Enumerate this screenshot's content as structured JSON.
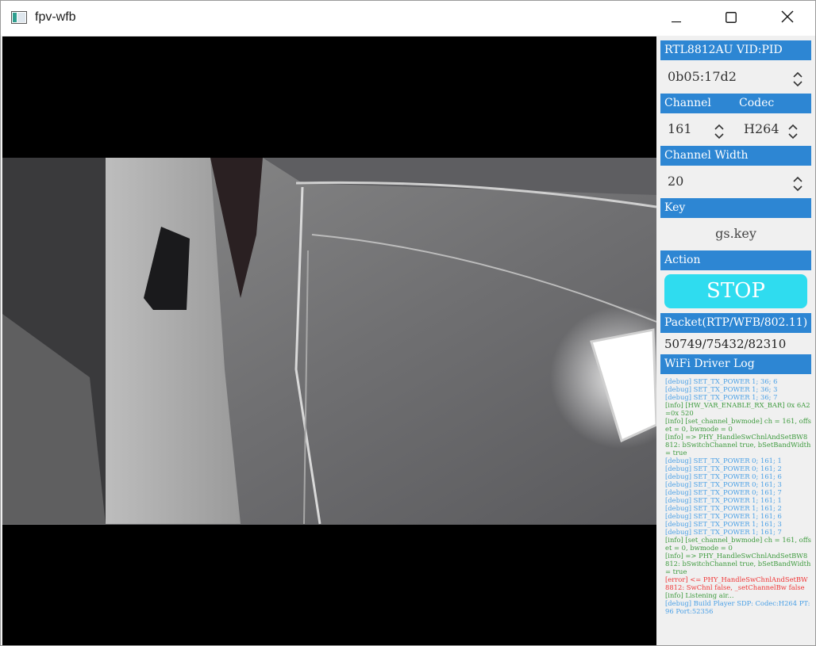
{
  "window": {
    "title": "fpv-wfb"
  },
  "sidebar": {
    "device": {
      "header": "RTL8812AU VID:PID",
      "value": "0b05:17d2"
    },
    "channel": {
      "header": "Channel",
      "value": "161"
    },
    "codec": {
      "header": "Codec",
      "value": "H264"
    },
    "channel_width": {
      "header": "Channel Width",
      "value": "20"
    },
    "key": {
      "header": "Key",
      "value": "gs.key"
    },
    "action": {
      "header": "Action",
      "button_label": "STOP"
    },
    "packet": {
      "header": "Packet(RTP/WFB/802.11)",
      "value": "50749/75432/82310"
    },
    "log": {
      "header": "WiFi Driver Log",
      "lines": [
        {
          "level": "debug",
          "text": "[debug] SET_TX_POWER 1; 36; 6"
        },
        {
          "level": "debug",
          "text": "[debug] SET_TX_POWER 1; 36; 3"
        },
        {
          "level": "debug",
          "text": "[debug] SET_TX_POWER 1; 36; 7"
        },
        {
          "level": "info",
          "text": "[info] [HW_VAR_ENABLE_RX_BAR] 0x 6A2=0x 520"
        },
        {
          "level": "info",
          "text": "[info] [set_channel_bwmode] ch = 161, offset = 0, bwmode = 0"
        },
        {
          "level": "info",
          "text": "[info] => PHY_HandleSwChnlAndSetBW8812: bSwitchChannel true, bSetBandWidth = true"
        },
        {
          "level": "debug",
          "text": "[debug] SET_TX_POWER 0; 161; 1"
        },
        {
          "level": "debug",
          "text": "[debug] SET_TX_POWER 0; 161; 2"
        },
        {
          "level": "debug",
          "text": "[debug] SET_TX_POWER 0; 161; 6"
        },
        {
          "level": "debug",
          "text": "[debug] SET_TX_POWER 0; 161; 3"
        },
        {
          "level": "debug",
          "text": "[debug] SET_TX_POWER 0; 161; 7"
        },
        {
          "level": "debug",
          "text": "[debug] SET_TX_POWER 1; 161; 1"
        },
        {
          "level": "debug",
          "text": "[debug] SET_TX_POWER 1; 161; 2"
        },
        {
          "level": "debug",
          "text": "[debug] SET_TX_POWER 1; 161; 6"
        },
        {
          "level": "debug",
          "text": "[debug] SET_TX_POWER 1; 161; 3"
        },
        {
          "level": "debug",
          "text": "[debug] SET_TX_POWER 1; 161; 7"
        },
        {
          "level": "info",
          "text": "[info] [set_channel_bwmode] ch = 161, offset = 0, bwmode = 0"
        },
        {
          "level": "info",
          "text": "[info] => PHY_HandleSwChnlAndSetBW8812: bSwitchChannel true, bSetBandWidth = true"
        },
        {
          "level": "error",
          "text": "[error] <= PHY_HandleSwChnlAndSetBW8812: SwChnl false, _setChannelBw false"
        },
        {
          "level": "info",
          "text": "[info] Listening air..."
        },
        {
          "level": "debug",
          "text": "[debug] Build Player SDP: Codec:H264 PT:96 Port:52356"
        }
      ]
    }
  },
  "colors": {
    "header_bg": "#2d86d3",
    "stop_button": "#2fdcef",
    "log_debug": "#4aa0e6",
    "log_info": "#3d9a3d",
    "log_error": "#f03636"
  },
  "icons": {
    "app": "app-window-icon",
    "minimize": "minimize-icon",
    "maximize": "maximize-icon",
    "close": "close-icon",
    "spinner": "up-down-chevron-icon"
  }
}
